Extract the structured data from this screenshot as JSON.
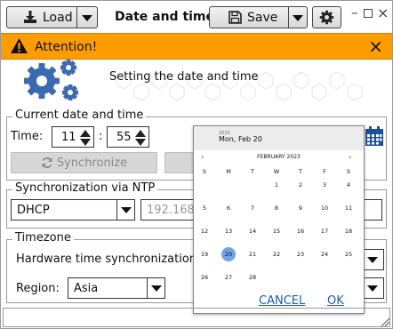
{
  "toolbar": {
    "load_label": "Load",
    "title": "Date and time",
    "save_label": "Save"
  },
  "alert": {
    "text": "Attention!"
  },
  "hero": {
    "text": "Setting the date and time"
  },
  "current": {
    "group_title": "Current date and time",
    "time_label": "Time:",
    "hours": "11",
    "separator": ":",
    "minutes": "55",
    "sync_label": "Synchronize"
  },
  "ntp": {
    "group_title": "Synchronization via NTP",
    "mode": "DHCP",
    "server": "192.168.0."
  },
  "timezone": {
    "group_title": "Timezone",
    "hw_sync_label": "Hardware time synchronization:",
    "region_label": "Region:",
    "region": "Asia"
  },
  "calendar": {
    "year": "2023",
    "selected_date": "Mon, Feb 20",
    "month_label": "FEBRUARY 2023",
    "prev": "‹",
    "next": "›",
    "weekdays": [
      "S",
      "M",
      "T",
      "W",
      "T",
      "F",
      "S"
    ],
    "days": [
      [
        "",
        "",
        "",
        "1",
        "2",
        "3",
        "4"
      ],
      [
        "5",
        "6",
        "7",
        "8",
        "9",
        "10",
        "11"
      ],
      [
        "12",
        "13",
        "14",
        "15",
        "16",
        "17",
        "18"
      ],
      [
        "19",
        "20",
        "21",
        "22",
        "23",
        "24",
        "25"
      ],
      [
        "26",
        "27",
        "28",
        "",
        "",
        "",
        ""
      ]
    ],
    "selected_day": "20",
    "cancel_label": "CANCEL",
    "ok_label": "OK"
  },
  "icons": {
    "load": "download-icon",
    "save": "floppy-disk-icon",
    "settings": "gear-icon",
    "alert": "warning-icon",
    "sync": "refresh-icon",
    "calendar": "calendar-icon",
    "hero": "gears-icon"
  },
  "colors": {
    "alert_bg": "#ff9c00",
    "selected_day": "#6ea3e6",
    "link": "#1f5da8",
    "calendar_icon": "#1f4e9a",
    "gears": "#3a6bb0"
  }
}
